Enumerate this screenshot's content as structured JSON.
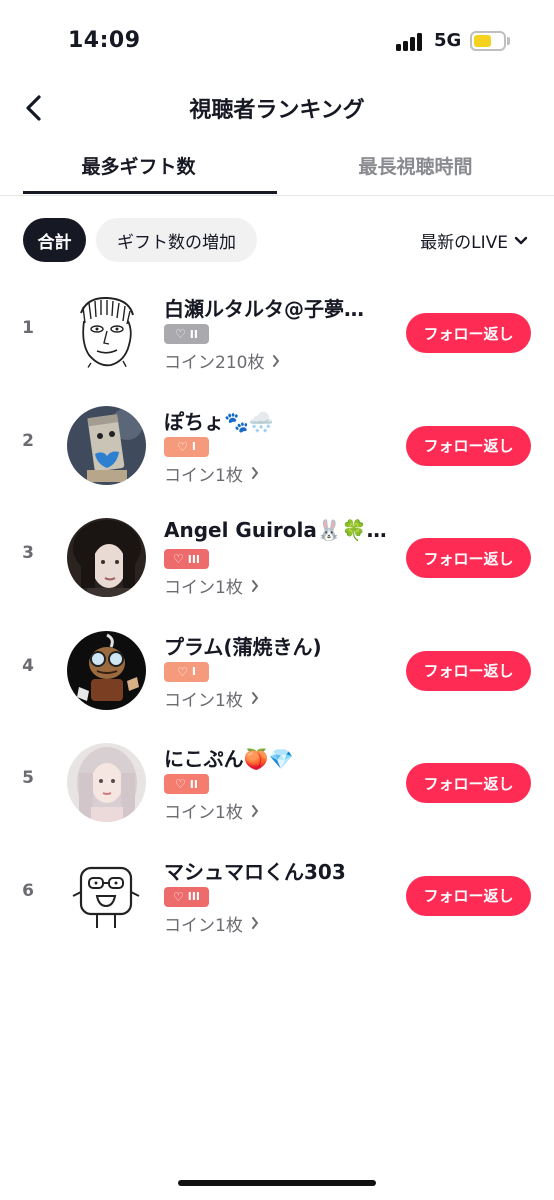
{
  "status": {
    "time": "14:09",
    "network": "5G",
    "battery_level": 0.62
  },
  "header": {
    "title": "視聴者ランキング",
    "back_icon": "chevron-left-icon"
  },
  "tabs": [
    {
      "label": "最多ギフト数",
      "active": true
    },
    {
      "label": "最長視聴時間",
      "active": false
    }
  ],
  "filters": {
    "total": "合計",
    "increase": "ギフト数の増加",
    "period": "最新のLIVE"
  },
  "colors": {
    "accent": "#fe2c55",
    "text": "#161823",
    "muted": "#8a8b91"
  },
  "ranking": [
    {
      "rank": "1",
      "name": "白瀬ルタルタ@子夢…",
      "badge": "II",
      "badge_color": "#a9a9ae",
      "coins": "コイン210枚",
      "action": "フォロー返し"
    },
    {
      "rank": "2",
      "name": "ぽちょ🐾🌨️",
      "badge": "I",
      "badge_color": "#f59a7c",
      "coins": "コイン1枚",
      "action": "フォロー返し"
    },
    {
      "rank": "3",
      "name": "Angel Guirola🐰🍀…",
      "badge": "III",
      "badge_color": "#ee6b6b",
      "coins": "コイン1枚",
      "action": "フォロー返し"
    },
    {
      "rank": "4",
      "name": "プラム(蒲焼きん)",
      "badge": "I",
      "badge_color": "#f59a7c",
      "coins": "コイン1枚",
      "action": "フォロー返し"
    },
    {
      "rank": "5",
      "name": "にこぷん🍑💎",
      "badge": "II",
      "badge_color": "#f47d70",
      "coins": "コイン1枚",
      "action": "フォロー返し"
    },
    {
      "rank": "6",
      "name": "マシュマロくん303",
      "badge": "III",
      "badge_color": "#ee6b6b",
      "coins": "コイン1枚",
      "action": "フォロー返し"
    }
  ]
}
